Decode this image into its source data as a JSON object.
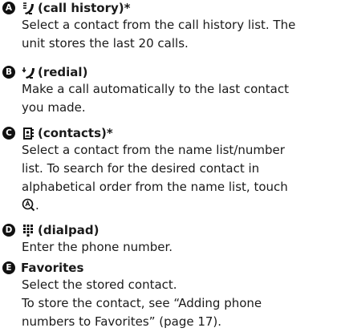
{
  "items": [
    {
      "badge": "A",
      "icon": "call-history-icon",
      "title": "(call history)*",
      "lines": [
        "Select a contact from the call history list. The",
        "unit stores the last 20 calls."
      ]
    },
    {
      "badge": "B",
      "icon": "redial-icon",
      "title": "(redial)",
      "lines": [
        "Make a call automatically to the last contact",
        "you made."
      ]
    },
    {
      "badge": "C",
      "icon": "contacts-icon",
      "title": "(contacts)*",
      "lines": [
        "Select a contact from the name list/number",
        "list. To search for the desired contact in",
        "alphabetical order from the name list, touch",
        "."
      ],
      "inline_icon": "search-abc-icon"
    },
    {
      "badge": "D",
      "icon": "dialpad-icon",
      "title": "(dialpad)",
      "lines": [
        "Enter the phone number."
      ]
    },
    {
      "badge": "E",
      "icon": "",
      "title": "Favorites",
      "lines": [
        "Select the stored contact.",
        "To store the contact, see “Adding phone",
        "numbers to Favorites” (page 17)."
      ]
    }
  ]
}
